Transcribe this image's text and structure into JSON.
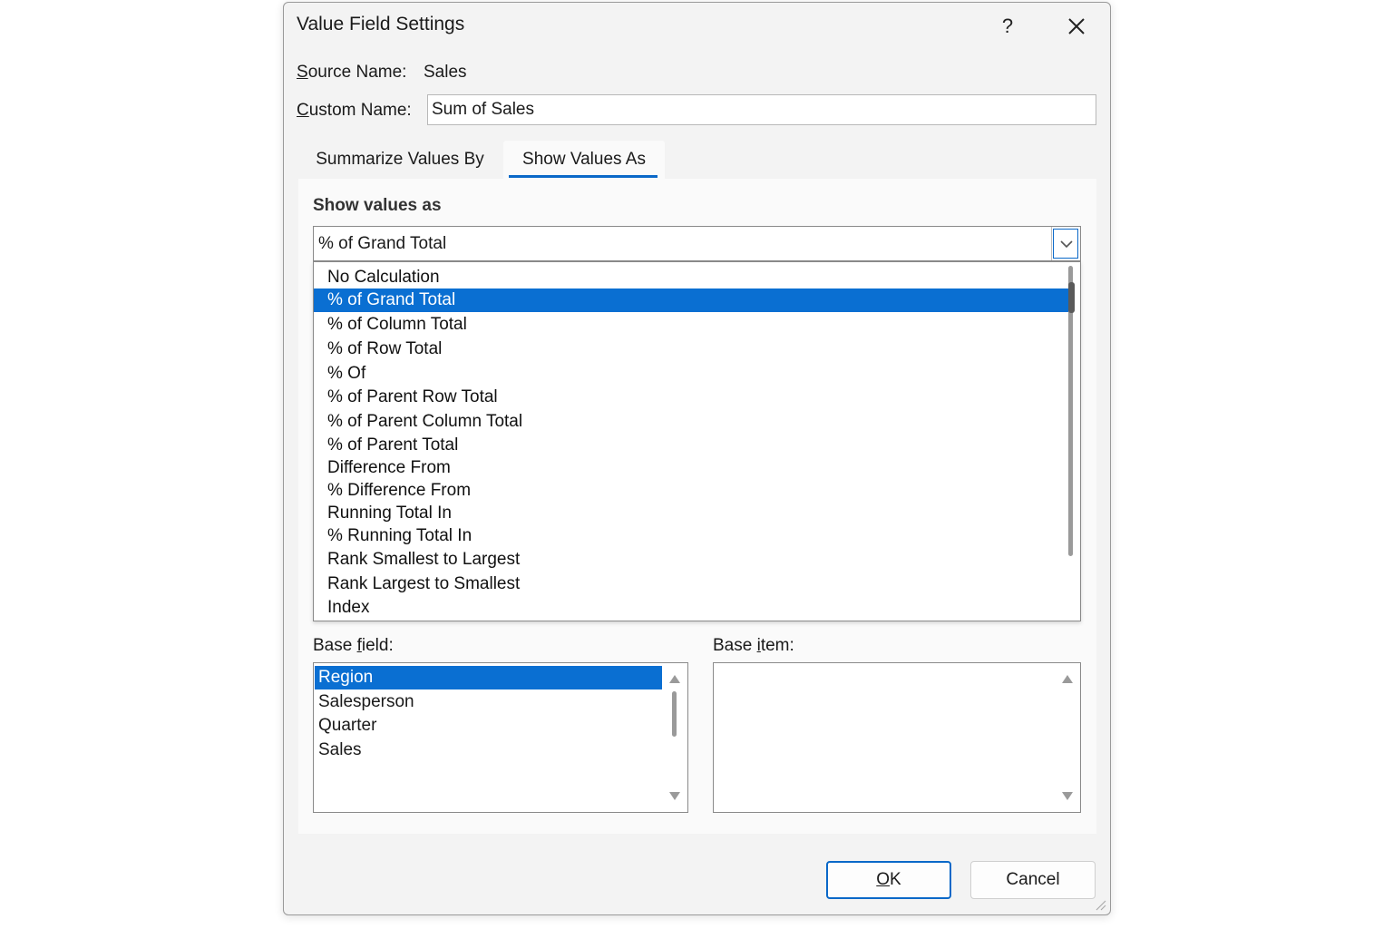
{
  "dialog": {
    "title": "Value Field Settings",
    "help_glyph": "?",
    "close_glyph": "✕"
  },
  "source": {
    "label_accel": "S",
    "label_rest": "ource Name:",
    "value": "Sales"
  },
  "custom_name": {
    "label_accel": "C",
    "label_rest": "ustom Name:",
    "value": "Sum of Sales"
  },
  "tabs": [
    {
      "label": "Summarize Values By",
      "active": false
    },
    {
      "label": "Show Values As",
      "active": true
    }
  ],
  "show_values": {
    "section_title": "Show values as",
    "selected": "% of Grand Total",
    "options": [
      "No Calculation",
      "% of Grand Total",
      "% of Column Total",
      "% of Row Total",
      "% Of",
      "% of Parent Row Total",
      "% of Parent Column Total",
      "% of Parent Total",
      "Difference From",
      "% Difference From",
      "Running Total In",
      "% Running Total In",
      "Rank Smallest to Largest",
      "Rank Largest to Smallest",
      "Index"
    ],
    "highlighted_index": 1
  },
  "base_field": {
    "label_before": "Base ",
    "label_accel": "f",
    "label_after": "ield:",
    "items": [
      "Region",
      "Salesperson",
      "Quarter",
      "Sales"
    ],
    "selected_index": 0
  },
  "base_item": {
    "label_before": "Base ",
    "label_accel": "i",
    "label_after": "tem:",
    "items": []
  },
  "buttons": {
    "ok_accel": "O",
    "ok_rest": "K",
    "cancel": "Cancel"
  },
  "colors": {
    "accent": "#0a68c8",
    "selection": "#0a6fd2"
  }
}
